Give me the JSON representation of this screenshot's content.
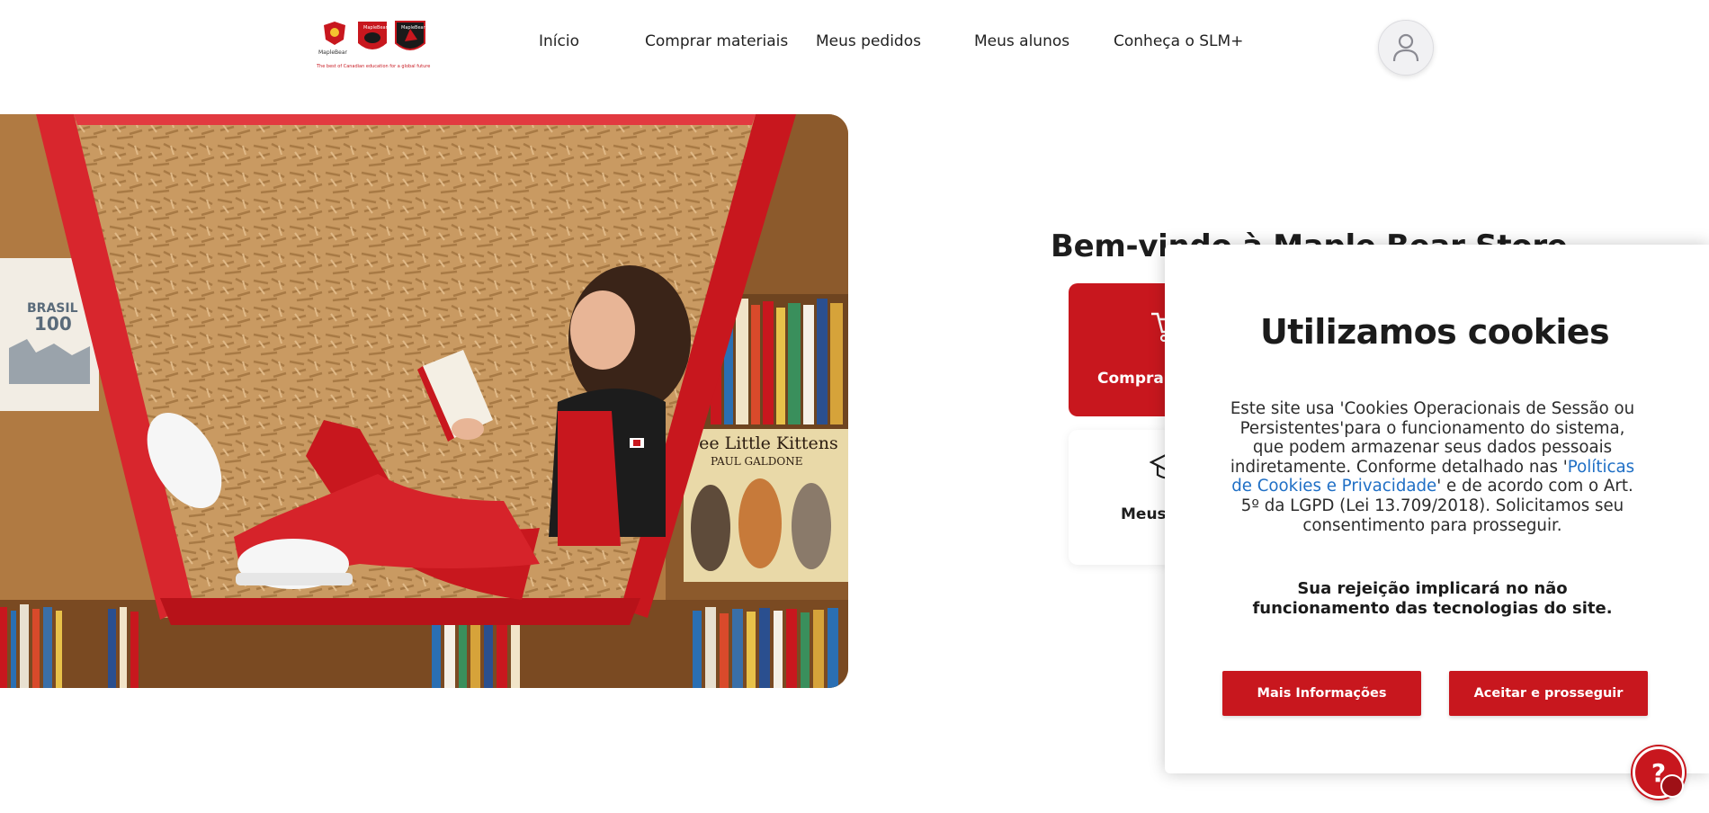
{
  "header": {
    "logo_tagline": "The best of Canadian education for a global future",
    "logo_text": "MapleBear",
    "nav": [
      {
        "label": "Início"
      },
      {
        "label": "Comprar materiais"
      },
      {
        "label": "Meus pedidos"
      },
      {
        "label": "Meus alunos"
      },
      {
        "label": "Conheça o SLM+"
      }
    ],
    "avatar_icon": "user-icon"
  },
  "hero": {
    "book_text_brasil": "BRASIL",
    "book_text_100": "100",
    "book_text_kittens": "ree Little Kittens",
    "book_text_author": "PAUL GALDONE"
  },
  "welcome": {
    "title": "Bem-vindo à Maple Bear Store",
    "cards": [
      {
        "label": "Comprar materiais",
        "icon": "cart-icon"
      },
      {
        "label": "Meus alunos",
        "icon": "graduation-cap-icon"
      }
    ]
  },
  "cookie": {
    "title": "Utilizamos cookies",
    "body_before": "Este site usa 'Cookies Operacionais de Sessão ou Persistentes'para o funcionamento do sistema, que podem armazenar seus dados pessoais indiretamente. Conforme detalhado nas '",
    "body_link": "Políticas de Cookies e Privacidade",
    "body_after": "' e de acordo com o Art. 5º da LGPD (Lei 13.709/2018). Solicitamos seu consentimento para prosseguir.",
    "warning": "Sua rejeição implicará no não funcionamento das tecnologias do site.",
    "btn_info": "Mais Informações",
    "btn_accept": "Aceitar e prosseguir"
  },
  "help": {
    "symbol": "?",
    "icon": "help-chat-icon"
  },
  "colors": {
    "brand_red": "#c8171e",
    "link_blue": "#1f6fc5"
  }
}
